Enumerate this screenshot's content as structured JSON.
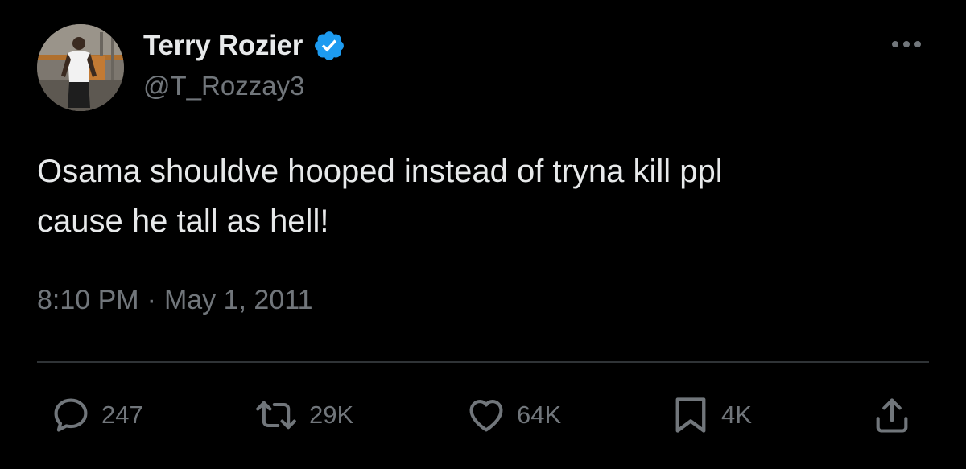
{
  "tweet": {
    "display_name": "Terry Rozier",
    "handle": "@T_Rozzay3",
    "verified": true,
    "text_lines": [
      "Osama shouldve hooped instead of tryna kill ppl",
      "cause he tall as hell!"
    ],
    "time": "8:10 PM",
    "separator": "·",
    "date": "May 1, 2011"
  },
  "actions": {
    "replies": "247",
    "reposts": "29K",
    "likes": "64K",
    "bookmarks": "4K"
  },
  "icons": {
    "verified": "verified-badge-icon",
    "more": "more-icon",
    "reply": "reply-icon",
    "repost": "repost-icon",
    "like": "heart-icon",
    "bookmark": "bookmark-icon",
    "share": "share-icon"
  },
  "colors": {
    "background": "#000000",
    "primary_text": "#e7e9ea",
    "secondary_text": "#71767b",
    "verified_blue": "#1d9bf0",
    "divider": "#2f3336"
  }
}
